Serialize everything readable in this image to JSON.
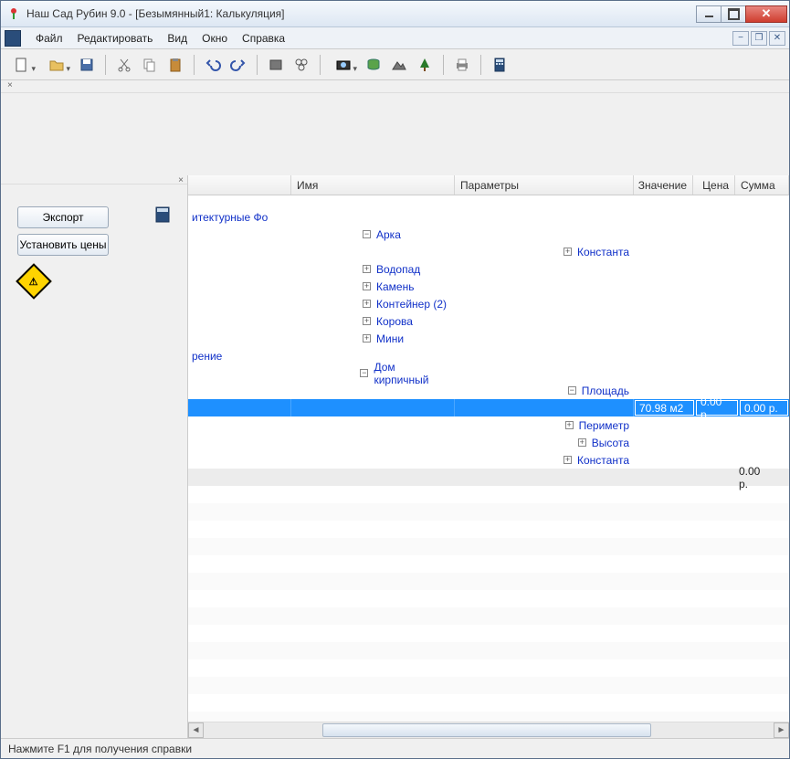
{
  "window": {
    "title": "Наш Сад Рубин 9.0 - [Безымянный1: Калькуляция]"
  },
  "menu": {
    "items": [
      "Файл",
      "Редактировать",
      "Вид",
      "Окно",
      "Справка"
    ]
  },
  "sidebar": {
    "buttons": {
      "export": "Экспорт",
      "prices": "Установить цены"
    }
  },
  "grid": {
    "headers": {
      "name": "Имя",
      "params": "Параметры",
      "value": "Значение",
      "price": "Цена",
      "sum": "Сумма"
    },
    "categories": [
      {
        "label": "итектурные Фо",
        "items": [
          {
            "name": "Арка",
            "expanded": true,
            "params": [
              {
                "name": "Константа",
                "expanded": false
              }
            ]
          },
          {
            "name": "Водопад",
            "expanded": false
          },
          {
            "name": "Камень",
            "expanded": false
          },
          {
            "name": "Контейнер (2)",
            "expanded": false
          },
          {
            "name": "Корова",
            "expanded": false
          },
          {
            "name": "Мини",
            "expanded": false
          }
        ]
      },
      {
        "label": "рение",
        "items": [
          {
            "name": "Дом кирпичный",
            "expanded": true,
            "params": [
              {
                "name": "Площадь",
                "expanded": true,
                "value": "70.98 м2",
                "price": "0.00 р.",
                "sum": "0.00 р.",
                "selected": true
              },
              {
                "name": "Периметр",
                "expanded": false
              },
              {
                "name": "Высота",
                "expanded": false
              },
              {
                "name": "Константа",
                "expanded": false
              }
            ]
          }
        ]
      }
    ],
    "total_sum": "0.00 р."
  },
  "statusbar": {
    "hint": "Нажмите F1 для получения справки"
  }
}
